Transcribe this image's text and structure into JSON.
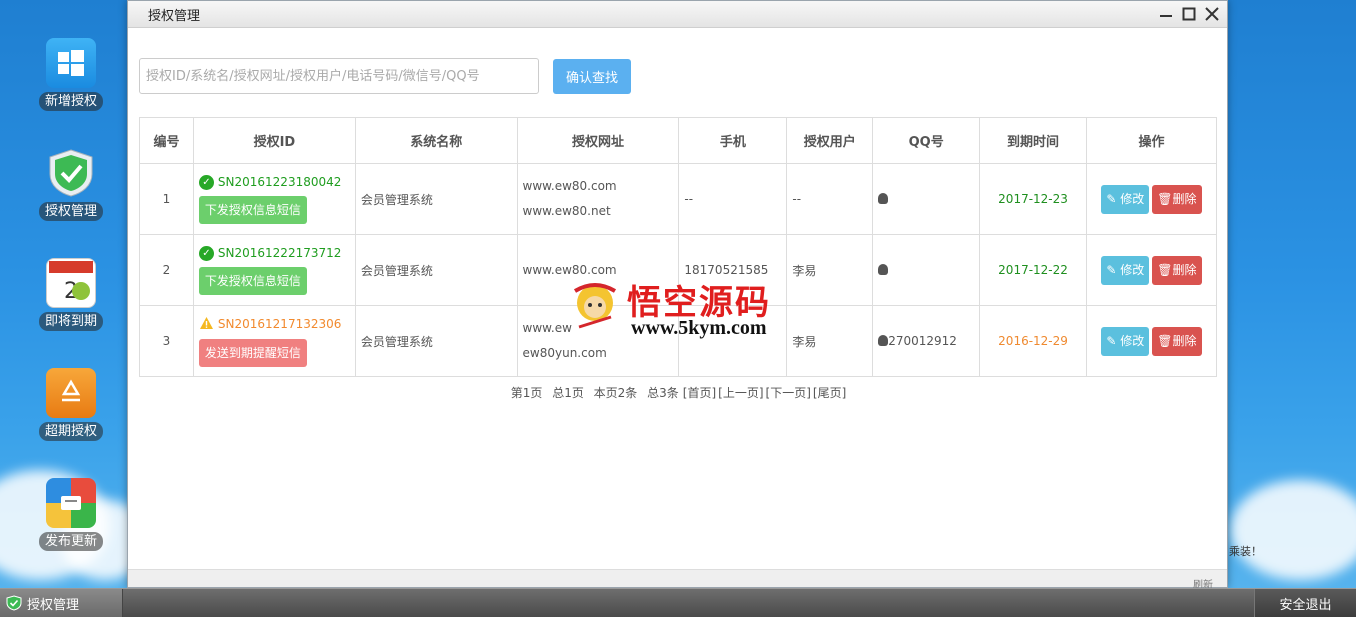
{
  "desktop": {
    "icons": [
      {
        "label": "新增授权",
        "icon": "windows-icon"
      },
      {
        "label": "授权管理",
        "icon": "shield-check-icon"
      },
      {
        "label": "即将到期",
        "icon": "calendar-icon"
      },
      {
        "label": "超期授权",
        "icon": "recycle-icon"
      },
      {
        "label": "发布更新",
        "icon": "inbox-icon"
      }
    ],
    "side_text": "乘装！"
  },
  "window": {
    "title": "授权管理",
    "controls": [
      "minimize-icon",
      "maximize-icon",
      "close-icon"
    ],
    "footer_text": "刷新"
  },
  "search": {
    "placeholder": "授权ID/系统名/授权网址/授权用户/电话号码/微信号/QQ号",
    "button_label": "确认查找"
  },
  "table": {
    "headers": [
      "编号",
      "授权ID",
      "系统名称",
      "授权网址",
      "手机",
      "授权用户",
      "QQ号",
      "到期时间",
      "操作"
    ],
    "rows": [
      {
        "num": "1",
        "status": "ok",
        "sn": "SN20161223180042",
        "sms_label": "下发授权信息短信",
        "system": "会员管理系统",
        "url1": "www.ew80.com",
        "url2": "www.ew80.net",
        "phone": "--",
        "user": "--",
        "qq": "",
        "expiry": "2017-12-23",
        "expiry_state": "green",
        "edit_label": "修改",
        "delete_label": "删除"
      },
      {
        "num": "2",
        "status": "ok",
        "sn": "SN20161222173712",
        "sms_label": "下发授权信息短信",
        "system": "会员管理系统",
        "url1": "www.ew80.com",
        "url2": "",
        "phone": "18170521585",
        "user": "李易",
        "qq": "",
        "expiry": "2017-12-22",
        "expiry_state": "green",
        "edit_label": "修改",
        "delete_label": "删除"
      },
      {
        "num": "3",
        "status": "warn",
        "sn": "SN20161217132306",
        "sms_label": "发送到期提醒短信",
        "system": "会员管理系统",
        "url1": "www.ew",
        "url2": "ew80yun.com",
        "phone": "",
        "user": "李易",
        "qq": "270012912",
        "expiry": "2016-12-29",
        "expiry_state": "orange",
        "edit_label": "修改",
        "delete_label": "删除"
      }
    ]
  },
  "pager": {
    "current": "第1页",
    "total_pages": "总1页",
    "per_page": "本页2条",
    "total": "总3条",
    "first": "[首页]",
    "prev": "[上一页]",
    "next": "[下一页]",
    "last": "[尾页]"
  },
  "watermark": {
    "title": "悟空源码",
    "url": "www.5kym.com"
  },
  "taskbar": {
    "task_label": "授权管理",
    "logout_label": "安全退出"
  },
  "colors": {
    "accent_blue": "#5bb0f0",
    "ok_green": "#1f9d1f",
    "warn_orange": "#f28a2e",
    "edit_btn": "#5bc0de",
    "delete_btn": "#d9534f",
    "sms_green": "#6ccf6c",
    "sms_red": "#f08080"
  }
}
